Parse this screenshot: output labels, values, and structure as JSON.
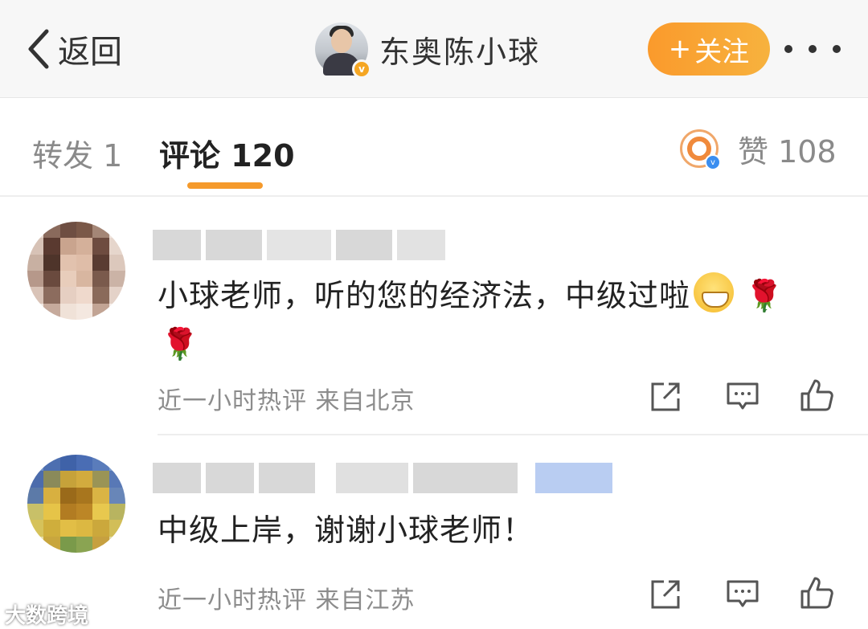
{
  "header": {
    "back_label": "返回",
    "profile_name": "东奥陈小球",
    "follow_label": "关注",
    "follow_plus": "+"
  },
  "tabs": {
    "repost": "转发 1",
    "comments": "评论 120",
    "likes": "赞 108"
  },
  "comments": [
    {
      "text": "小球老师，听的您的经济法，中级过啦",
      "emoji": "grin",
      "roses": [
        "🌹",
        "🌹"
      ],
      "meta": "近一小时热评  来自北京"
    },
    {
      "text": "中级上岸，谢谢小球老师！",
      "meta": "近一小时热评  来自江苏"
    }
  ],
  "watermark": "大数跨境",
  "colors": {
    "accent_orange": "#f59a2b",
    "header_bg": "#f7f7f7",
    "muted_text": "#8a8a8a"
  }
}
